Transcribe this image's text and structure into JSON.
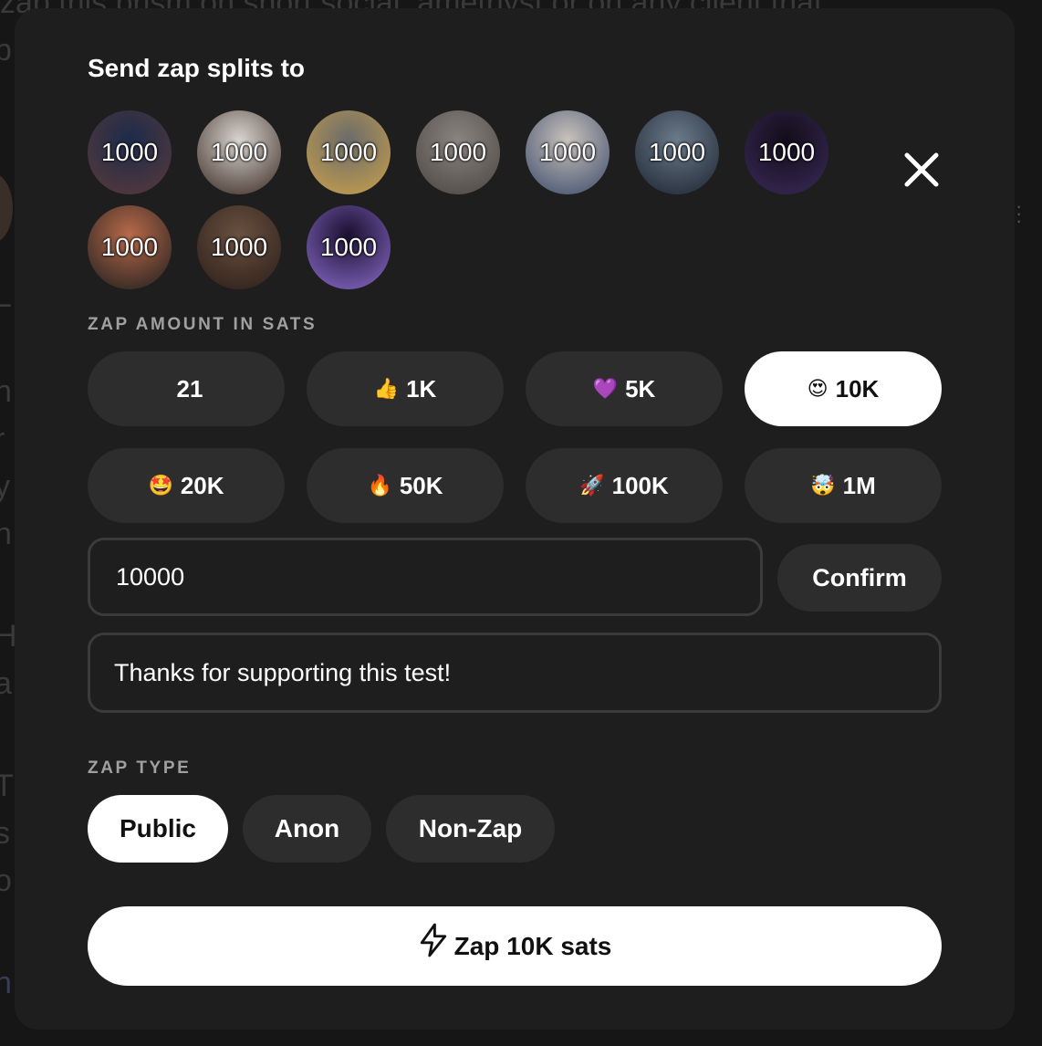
{
  "background": {
    "top_text": "zap this prism on short.social: amethyst or on any client that",
    "edge_letters": [
      "p",
      "L",
      "n",
      "r",
      "y",
      "n",
      "H",
      "a",
      "T",
      "s",
      "o",
      "n"
    ]
  },
  "modal": {
    "title": "Send zap splits to",
    "close_icon": "close-icon",
    "recipients": [
      {
        "amount": "1000",
        "colors": [
          "#1c2b4a",
          "#5a3a3a"
        ]
      },
      {
        "amount": "1000",
        "colors": [
          "#d9d4cf",
          "#3a2a22"
        ]
      },
      {
        "amount": "1000",
        "colors": [
          "#6b6b6b",
          "#c9a14a"
        ]
      },
      {
        "amount": "1000",
        "colors": [
          "#8a8480",
          "#4a4542"
        ]
      },
      {
        "amount": "1000",
        "colors": [
          "#c9c2bb",
          "#3a4a6a"
        ]
      },
      {
        "amount": "1000",
        "colors": [
          "#6b7a8a",
          "#1c2430"
        ]
      },
      {
        "amount": "1000",
        "colors": [
          "#120d18",
          "#3a2a5a"
        ]
      },
      {
        "amount": "1000",
        "colors": [
          "#b86a4a",
          "#1e1e1e"
        ]
      },
      {
        "amount": "1000",
        "colors": [
          "#6a5040",
          "#2a1e18"
        ]
      },
      {
        "amount": "1000",
        "colors": [
          "#1a1030",
          "#8a6ac9"
        ]
      }
    ],
    "amount_label": "ZAP AMOUNT IN SATS",
    "presets": [
      {
        "emoji": "",
        "label": "21"
      },
      {
        "emoji": "👍",
        "label": "1K"
      },
      {
        "emoji": "💜",
        "label": "5K"
      },
      {
        "emoji": "😍",
        "label": "10K"
      },
      {
        "emoji": "🤩",
        "label": "20K"
      },
      {
        "emoji": "🔥",
        "label": "50K"
      },
      {
        "emoji": "🚀",
        "label": "100K"
      },
      {
        "emoji": "🤯",
        "label": "1M"
      }
    ],
    "selected_preset": "10K",
    "amount_value": "10000",
    "confirm_label": "Confirm",
    "comment_value": "Thanks for supporting this test!",
    "type_label": "ZAP TYPE",
    "types": [
      "Public",
      "Anon",
      "Non-Zap"
    ],
    "selected_type": "Public",
    "zap_button_label": "Zap 10K sats",
    "zap_icon": "lightning-icon"
  }
}
